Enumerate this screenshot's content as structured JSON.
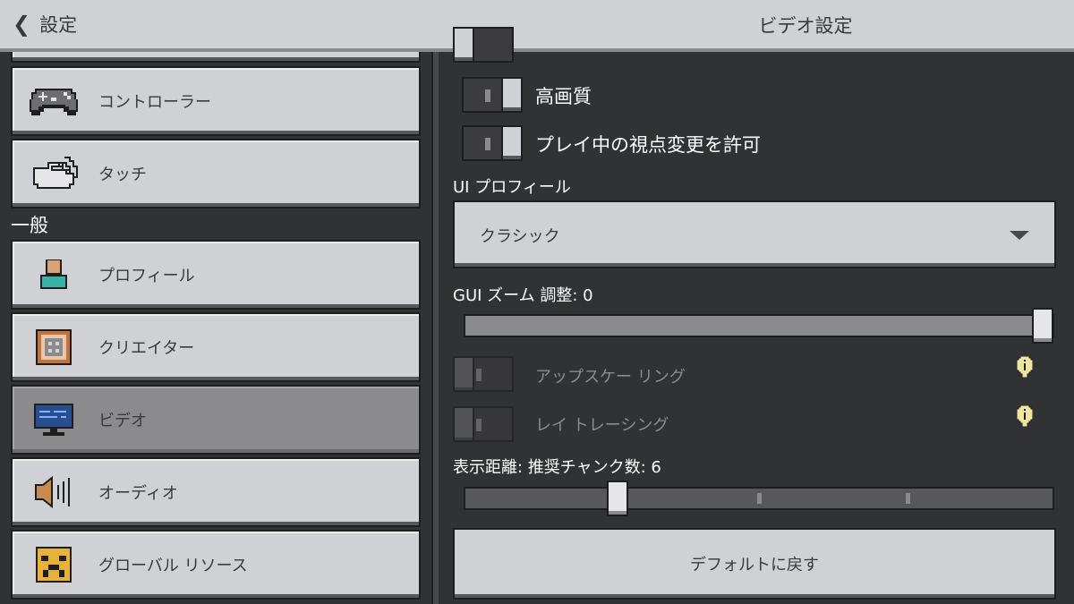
{
  "header": {
    "back_label": "設定",
    "title": "ビデオ設定"
  },
  "sidebar": {
    "section_general": "一般",
    "items": [
      {
        "label": "コントローラー",
        "icon": "gamepad-icon"
      },
      {
        "label": "タッチ",
        "icon": "touch-hand-icon"
      },
      {
        "label": "プロフィール",
        "icon": "profile-icon"
      },
      {
        "label": "クリエイター",
        "icon": "creator-icon"
      },
      {
        "label": "ビデオ",
        "icon": "monitor-icon",
        "selected": true
      },
      {
        "label": "オーディオ",
        "icon": "speaker-icon"
      },
      {
        "label": "グローバル リソース",
        "icon": "global-resources-icon"
      }
    ]
  },
  "video": {
    "high_quality_label": "高画質",
    "allow_view_change_label": "プレイ中の視点変更を許可",
    "ui_profile_label": "UI プロフィール",
    "ui_profile_value": "クラシック",
    "gui_zoom_label": "GUI ズーム 調整: 0",
    "gui_zoom_fraction": 1.0,
    "upscaling_label": "アップスケー リング",
    "ray_tracing_label": "レイ トレーシング",
    "render_distance_label": "表示距離: 推奨チャンク数: 6",
    "render_distance_fraction": 0.25,
    "reset_label": "デフォルトに戻す"
  },
  "colors": {
    "background": "#313233",
    "button": "#d0d1d4",
    "selected": "#8b8b8e",
    "info": "#f1e6a0"
  }
}
